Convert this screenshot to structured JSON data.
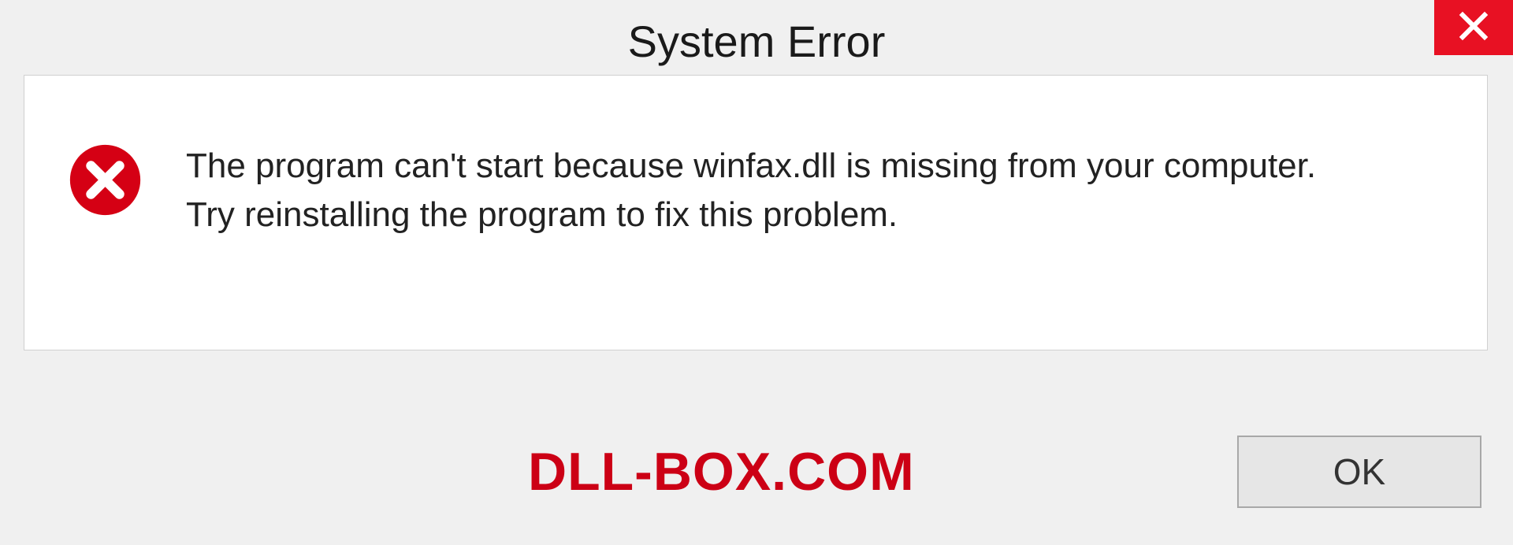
{
  "titlebar": {
    "title": "System Error"
  },
  "dialog": {
    "message_line1": "The program can't start because winfax.dll is missing from your computer.",
    "message_line2": "Try reinstalling the program to fix this problem."
  },
  "footer": {
    "watermark": "DLL-BOX.COM",
    "ok_label": "OK"
  },
  "colors": {
    "close_bg": "#e81123",
    "error_icon": "#d50014",
    "watermark": "#cc0015"
  }
}
